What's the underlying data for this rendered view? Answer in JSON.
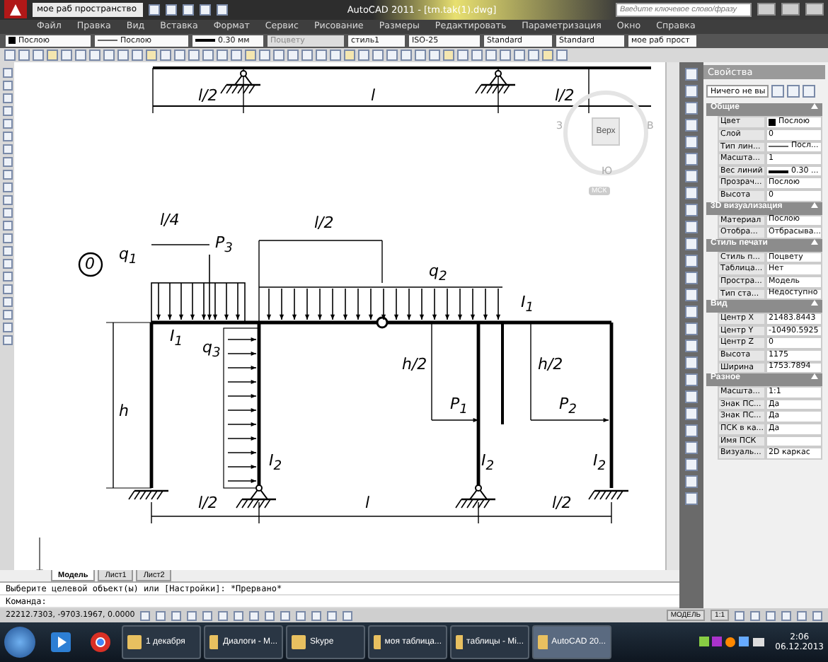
{
  "title_bar": {
    "workspace": "мое раб пространство",
    "title": "AutoCAD 2011 - [tm.tak(1).dwg]",
    "search_placeholder": "Введите ключевое слово/фразу"
  },
  "menu": [
    "Файл",
    "Правка",
    "Вид",
    "Вставка",
    "Формат",
    "Сервис",
    "Рисование",
    "Размеры",
    "Редактировать",
    "Параметризация",
    "Окно",
    "Справка"
  ],
  "toolbar_combos": [
    {
      "value": "Послою",
      "kind": "color"
    },
    {
      "value": "Послою",
      "kind": "line"
    },
    {
      "value": "0.30 мм",
      "kind": "weight"
    },
    {
      "value": "Поцвету",
      "kind": "disabled"
    },
    {
      "value": "стиль1",
      "kind": "text"
    },
    {
      "value": "ISO-25",
      "kind": "text"
    },
    {
      "value": "Standard",
      "kind": "text"
    },
    {
      "value": "Standard",
      "kind": "text"
    },
    {
      "value": "мое раб прост",
      "kind": "text"
    }
  ],
  "drawing": {
    "frame_number": "0",
    "labels": [
      "l/2",
      "l",
      "l/2",
      "l/4",
      "l/2",
      "P$_{3}$",
      "q$_{1}$",
      "q$_{2}$",
      "I$_{1}$",
      "q$_{3}$",
      "I$_{1}$",
      "h",
      "h/2",
      "h/2",
      "P$_{1}$",
      "P$_{2}$",
      "I$_{2}$",
      "I$_{2}$",
      "I$_{2}$",
      "l/2",
      "l",
      "l/2"
    ],
    "view_cube": {
      "top": "Верх",
      "west": "З",
      "east": "В",
      "south": "Ю",
      "ucs": "МСК"
    }
  },
  "layout_tabs": [
    {
      "label": "Модель",
      "selected": true
    },
    {
      "label": "Лист1",
      "selected": false
    },
    {
      "label": "Лист2",
      "selected": false
    }
  ],
  "command_lines": [
    "Выберите целевой объект(ы) или [Настройки]: *Прервано*",
    "Команда:"
  ],
  "status_bar": {
    "coordinates": "22212.7303, -9703.1967, 0.0000",
    "space": "МОДЕЛЬ",
    "scale": "1:1"
  },
  "properties": {
    "title": "Свойства",
    "selection": "Ничего не вы",
    "sections": [
      {
        "title": "Общие",
        "expanded": true,
        "rows": [
          {
            "name": "Цвет",
            "value": "Послою",
            "kind": "color"
          },
          {
            "name": "Слой",
            "value": "0",
            "kind": "text"
          },
          {
            "name": "Тип лин...",
            "value": "Посл...",
            "kind": "line"
          },
          {
            "name": "Масшта...",
            "value": "1",
            "kind": "text"
          },
          {
            "name": "Вес линий",
            "value": "0.30 ...",
            "kind": "weight"
          },
          {
            "name": "Прозрач...",
            "value": "Послою",
            "kind": "text"
          },
          {
            "name": "Высота",
            "value": "0",
            "kind": "text"
          }
        ]
      },
      {
        "title": "3D визуализация",
        "expanded": true,
        "rows": [
          {
            "name": "Материал",
            "value": "Послою",
            "kind": "text"
          },
          {
            "name": "Отобра...",
            "value": "Отбрасыва...",
            "kind": "text"
          }
        ]
      },
      {
        "title": "Стиль печати",
        "expanded": true,
        "rows": [
          {
            "name": "Стиль п...",
            "value": "Поцвету",
            "kind": "text"
          },
          {
            "name": "Таблица...",
            "value": "Нет",
            "kind": "text"
          },
          {
            "name": "Простра...",
            "value": "Модель",
            "kind": "text"
          },
          {
            "name": "Тип ста...",
            "value": "Недоступно",
            "kind": "text"
          }
        ]
      },
      {
        "title": "Вид",
        "expanded": true,
        "rows": [
          {
            "name": "Центр X",
            "value": "21483.8443",
            "kind": "text"
          },
          {
            "name": "Центр Y",
            "value": "-10490.5925",
            "kind": "text"
          },
          {
            "name": "Центр Z",
            "value": "0",
            "kind": "text"
          },
          {
            "name": "Высота",
            "value": "1175",
            "kind": "text"
          },
          {
            "name": "Ширина",
            "value": "1753.7894",
            "kind": "text"
          }
        ]
      },
      {
        "title": "Разное",
        "expanded": true,
        "rows": [
          {
            "name": "Масшта...",
            "value": "1:1",
            "kind": "text"
          },
          {
            "name": "Знак ПС...",
            "value": "Да",
            "kind": "text"
          },
          {
            "name": "Знак ПС...",
            "value": "Да",
            "kind": "text"
          },
          {
            "name": "ПСК в ка...",
            "value": "Да",
            "kind": "text"
          },
          {
            "name": "Имя ПСК",
            "kind": "text"
          },
          {
            "name": "Визуаль...",
            "value": "2D каркас",
            "kind": "text"
          }
        ]
      }
    ]
  },
  "taskbar": {
    "items": [
      {
        "label": "1 декабря",
        "selected": false
      },
      {
        "label": "Диалоги - M...",
        "selected": false
      },
      {
        "label": "Skype",
        "selected": false
      },
      {
        "label": "моя таблица...",
        "selected": false
      },
      {
        "label": "таблицы - Mi...",
        "selected": false
      },
      {
        "label": "AutoCAD 20...",
        "selected": true
      }
    ],
    "time": "2:06",
    "date": "06.12.2013"
  }
}
